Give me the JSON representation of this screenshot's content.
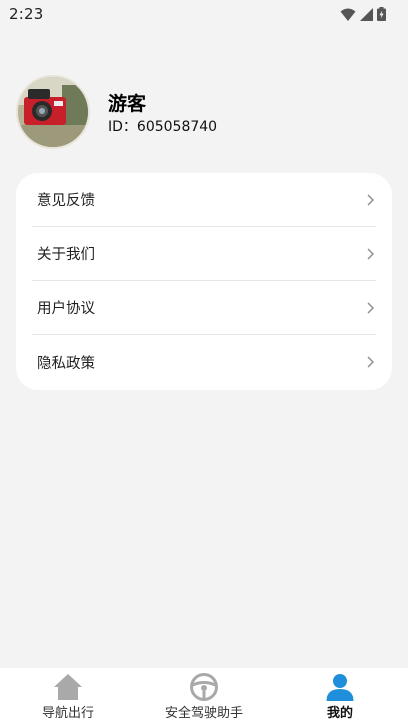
{
  "status_bar": {
    "time": "2:23",
    "icons": [
      "wifi-icon",
      "cellular-signal-icon",
      "battery-charging-icon"
    ]
  },
  "profile": {
    "avatar": "camera-photo-avatar",
    "name": "游客",
    "id_label": "ID",
    "id_separator": "：",
    "id_value": "605058740"
  },
  "menu": {
    "items": [
      {
        "label": "意见反馈",
        "icon": "chevron-right-icon"
      },
      {
        "label": "关于我们",
        "icon": "chevron-right-icon"
      },
      {
        "label": "用户协议",
        "icon": "chevron-right-icon"
      },
      {
        "label": "隐私政策",
        "icon": "chevron-right-icon"
      }
    ]
  },
  "bottom_nav": {
    "items": [
      {
        "label": "导航出行",
        "icon": "home-icon",
        "active": false
      },
      {
        "label": "安全驾驶助手",
        "icon": "steering-wheel-icon",
        "active": false
      },
      {
        "label": "我的",
        "icon": "person-icon",
        "active": true
      }
    ]
  },
  "colors": {
    "background": "#f3f3f3",
    "card": "#ffffff",
    "active_icon": "#1f8fdc",
    "inactive_icon": "#a9a9a9"
  }
}
